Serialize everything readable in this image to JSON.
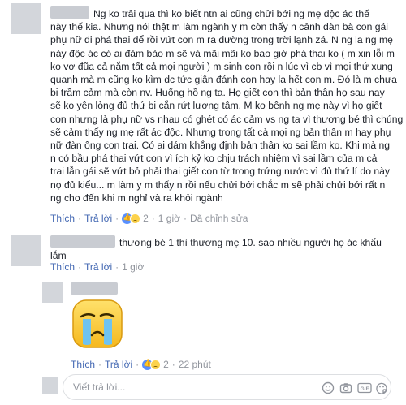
{
  "comments": [
    {
      "text": "Ng ko trải qua thì ko biết ntn ai cũng chửi bới ng mẹ độc ác thế\nnày thế kia. Nhưng nói thật m làm ngành y m còn thấy n cảnh đàn bà con gái\nphụ nữ đi phá thai để rồi vứt con m ra đường trong trời lạnh zá. N ng la ng mẹ\nnày độc ác có ai đảm bảo m sẽ và mãi mãi ko bao giờ phá thai ko ( m xin lỗi m\nko vơ đũa cả nắm tất cả mọi người ) m sinh con rồi n lúc vì cb vì mọi thứ xung\nquanh mà m cũng ko kìm dc tức giận đánh con hay la hết con m. Đó là m chưa\nbị trầm cảm mà còn nv. Huống hồ ng ta. Họ giết con thì bản thân họ sau nay\nsẽ ko yên lòng đủ thứ bị cắn rứt lương tâm. M ko bênh ng mẹ này vì họ giết\ncon nhưng là phụ nữ vs nhau có ghét có ác cảm vs ng ta vì thương bé thì chúng\nsẽ cảm thấy ng mẹ rất ác độc. Nhưng trong tất cả mọi ng bản thân m hay phụ\nnữ đàn ông con trai. Có ai dám khẳng định bản thân ko sai lầm ko. Khi mà ng\nn có bầu phá thai vứt con vì ích kỷ ko chịu trách nhiệm vì sai lầm của m cả\ntrai lẫn gái sẽ vứt bỏ phải thai giết con từ trong trứng nước vì đủ thứ lí do này\nnọ đủ kiểu... m làm y m thấy n rồi nếu chửi bới chắc m sẽ phải chửi bới rất n\nng cho đến khi m nghỉ và ra khỏi ngành",
      "actions": {
        "like": "Thích",
        "reply": "Trả lời",
        "reaction_count": "2",
        "time": "1 giờ",
        "edited": "Đã chỉnh sửa"
      }
    },
    {
      "text": "thương bé 1 thì thương mẹ 10. sao nhiều người họ ác khẩu\nlắm",
      "actions": {
        "like": "Thích",
        "reply": "Trả lời",
        "time": "1 giờ"
      }
    },
    {
      "sticker": "crying-face-sticker",
      "actions": {
        "like": "Thích",
        "reply": "Trả lời",
        "reaction_count": "2",
        "time": "22 phút"
      }
    }
  ],
  "reply_input": {
    "placeholder": "Viết trả lời..."
  },
  "separator": "·",
  "colors": {
    "link": "#4267b2",
    "meta": "#90949c",
    "text": "#1d2129",
    "reaction_like": "#5890ff",
    "reaction_face": "#fcd24c"
  },
  "icons": [
    "thumbs-up-icon",
    "face-reaction-icon",
    "smiley-icon",
    "camera-icon",
    "gif-icon",
    "sticker-icon"
  ]
}
